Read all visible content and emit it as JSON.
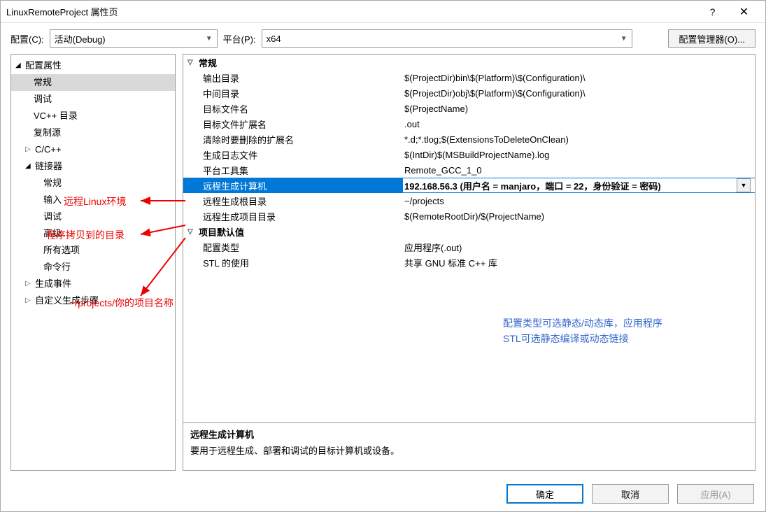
{
  "title": "LinuxRemoteProject 属性页",
  "toolbar": {
    "config_label": "配置(C):",
    "config_value": "活动(Debug)",
    "platform_label": "平台(P):",
    "platform_value": "x64",
    "manager_button": "配置管理器(O)..."
  },
  "tree": {
    "root": "配置属性",
    "items": [
      "常规",
      "调试",
      "VC++ 目录",
      "复制源"
    ],
    "cpp": "C/C++",
    "linker": "链接器",
    "linker_items": [
      "常规",
      "输入",
      "调试",
      "高级",
      "所有选项",
      "命令行"
    ],
    "build_events": "生成事件",
    "custom_build": "自定义生成步骤"
  },
  "groups": {
    "general": "常规",
    "defaults": "项目默认值"
  },
  "props": {
    "output_dir_k": "输出目录",
    "output_dir_v": "$(ProjectDir)bin\\$(Platform)\\$(Configuration)\\",
    "int_dir_k": "中间目录",
    "int_dir_v": "$(ProjectDir)obj\\$(Platform)\\$(Configuration)\\",
    "target_name_k": "目标文件名",
    "target_name_v": "$(ProjectName)",
    "target_ext_k": "目标文件扩展名",
    "target_ext_v": ".out",
    "clean_ext_k": "清除时要删除的扩展名",
    "clean_ext_v": "*.d;*.tlog;$(ExtensionsToDeleteOnClean)",
    "build_log_k": "生成日志文件",
    "build_log_v": "$(IntDir)$(MSBuildProjectName).log",
    "toolset_k": "平台工具集",
    "toolset_v": "Remote_GCC_1_0",
    "remote_machine_k": "远程生成计算机",
    "remote_machine_v": "192.168.56.3 (用户名 = manjaro，端口 = 22，身份验证 = 密码)",
    "remote_root_k": "远程生成根目录",
    "remote_root_v": "~/projects",
    "remote_proj_k": "远程生成项目目录",
    "remote_proj_v": "$(RemoteRootDir)/$(ProjectName)",
    "config_type_k": "配置类型",
    "config_type_v": "应用程序(.out)",
    "stl_k": "STL 的使用",
    "stl_v": "共享 GNU 标准 C++ 库"
  },
  "description": {
    "title": "远程生成计算机",
    "body": "要用于远程生成、部署和调试的目标计算机或设备。"
  },
  "buttons": {
    "ok": "确定",
    "cancel": "取消",
    "apply": "应用(A)"
  },
  "annotations": {
    "a1": "远程Linux环境",
    "a2": "程序拷贝到的目录",
    "a3": "~/projects/你的项目名称",
    "blue1": "配置类型可选静态/动态库，应用程序",
    "blue2": "STL可选静态编译或动态链接"
  }
}
